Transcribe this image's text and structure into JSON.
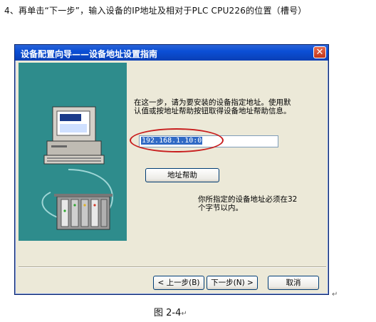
{
  "document": {
    "heading": "4、再单击“下一步”，输入设备的IP地址及相对于PLC CPU226的位置（槽号）",
    "caption": "图 2-4",
    "paragraph_mark": "↵"
  },
  "dialog": {
    "title": "设备配置向导——设备地址设置指南",
    "close_glyph": "✕",
    "instruction": "在这一步，请为要安装的设备指定地址。使用默认值或按地址帮助按钮取得设备地址帮助信息。",
    "address_value": "192.168.1.10:0",
    "address_help_button": "地址帮助",
    "note": "你所指定的设备地址必须在32个字节以内。",
    "buttons": {
      "back": "< 上一步(B)",
      "next": "下一步(N) >",
      "cancel": "取消"
    }
  },
  "colors": {
    "titlebar": "#0b4fd6",
    "dialog_bg": "#ece9d8",
    "art_bg": "#2e8c8c",
    "highlight": "#c81e1e",
    "selection": "#316ac5"
  },
  "icons": {
    "computer": "computer-icon",
    "plc": "plc-rack-icon",
    "close": "close-icon"
  }
}
